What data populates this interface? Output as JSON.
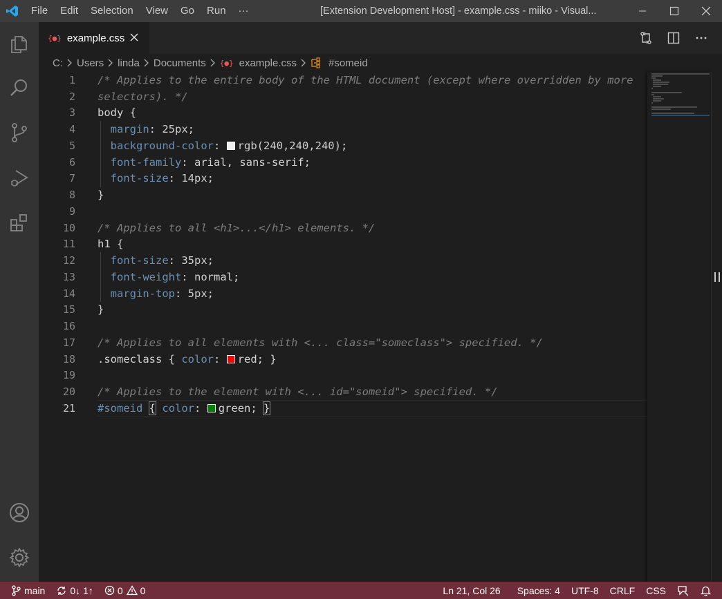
{
  "titlebar": {
    "menu": [
      "File",
      "Edit",
      "Selection",
      "View",
      "Go",
      "Run",
      "···"
    ],
    "title": "[Extension Development Host] - example.css - miiko - Visual..."
  },
  "tab": {
    "badge": "{●}",
    "label": "example.css"
  },
  "breadcrumb": {
    "items": [
      "C:",
      "Users",
      "linda",
      "Documents"
    ],
    "file_badge": "{●}",
    "file": "example.css",
    "symbol": "#someid"
  },
  "editor": {
    "line_numbers": [
      "1",
      "2",
      "3",
      "4",
      "5",
      "6",
      "7",
      "8",
      "9",
      "10",
      "11",
      "12",
      "13",
      "14",
      "15",
      "16",
      "17",
      "18",
      "19",
      "20",
      "21"
    ],
    "active_line": "21",
    "lines": {
      "l1": "/* Applies to the entire body of the HTML document (except where overridden by more",
      "l2": "selectors). */",
      "l3_sel": "body",
      "l3_brace": " {",
      "l4_prop": "margin",
      "l4_val": "25px",
      "l5_prop": "background-color",
      "l5_val": "rgb(240,240,240)",
      "l6_prop": "font-family",
      "l6_val": "arial, sans-serif",
      "l7_prop": "font-size",
      "l7_val": "14px",
      "l8": "}",
      "l10": "/* Applies to all <h1>...</h1> elements. */",
      "l11_sel": "h1",
      "l11_brace": " {",
      "l12_prop": "font-size",
      "l12_val": "35px",
      "l13_prop": "font-weight",
      "l13_val": "normal",
      "l14_prop": "margin-top",
      "l14_val": "5px",
      "l15": "}",
      "l17": "/* Applies to all elements with <... class=\"someclass\"> specified. */",
      "l18_sel": ".someclass",
      "l18_prop": "color",
      "l18_val": "red",
      "l20": "/* Applies to the element with <... id=\"someid\"> specified. */",
      "l21_sel": "#someid",
      "l21_prop": "color",
      "l21_val": "green"
    },
    "swatch_colors": {
      "bg": "#f0f0f0",
      "red": "#ff0000",
      "green": "#008000"
    }
  },
  "statusbar": {
    "branch": "main",
    "sync": "0↓ 1↑",
    "errors": "0",
    "warnings": "0",
    "position": "Ln 21, Col 26",
    "spaces": "Spaces: 4",
    "encoding": "UTF-8",
    "eol": "CRLF",
    "language": "CSS"
  },
  "colors": {
    "statusbar": "#6e2d38",
    "accent_logo": "#23a9f2"
  }
}
